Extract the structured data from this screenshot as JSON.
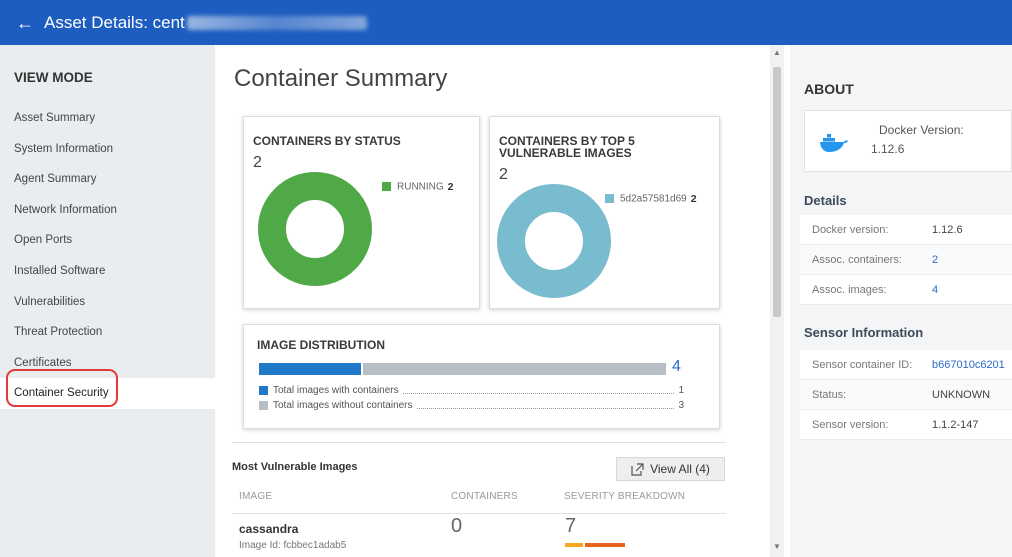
{
  "header": {
    "back_glyph": "←",
    "title": "Asset Details: cent"
  },
  "sidebar": {
    "heading": "VIEW MODE",
    "items": [
      {
        "label": "Asset Summary"
      },
      {
        "label": "System Information"
      },
      {
        "label": "Agent Summary"
      },
      {
        "label": "Network Information"
      },
      {
        "label": "Open Ports"
      },
      {
        "label": "Installed Software"
      },
      {
        "label": "Vulnerabilities"
      },
      {
        "label": "Threat Protection"
      },
      {
        "label": "Certificates"
      },
      {
        "label": "Container Security"
      }
    ],
    "active_index": 9
  },
  "main": {
    "title": "Container Summary",
    "status_card": {
      "title": "CONTAINERS BY STATUS",
      "count": "2",
      "legend_label": "RUNNING",
      "legend_value": "2",
      "color": "#4fa946"
    },
    "vuln_card": {
      "title_line1": "CONTAINERS BY TOP 5",
      "title_line2": "VULNERABLE IMAGES",
      "count": "2",
      "legend_label": "5d2a57581d69",
      "legend_value": "2",
      "color": "#79bcd0"
    },
    "image_dist": {
      "title": "IMAGE DISTRIBUTION",
      "total": "4",
      "with_fraction": 0.25,
      "with_label": "Total images with containers",
      "with_value": "1",
      "without_label": "Total images without containers",
      "without_value": "3",
      "with_color": "#1f78c8",
      "without_color": "#b7bec5"
    },
    "most_vulnerable": {
      "title": "Most Vulnerable Images",
      "view_all": "View All (4)",
      "columns": [
        "IMAGE",
        "CONTAINERS",
        "SEVERITY BREAKDOWN"
      ],
      "rows": [
        {
          "name": "cassandra",
          "image_id": "Image Id: fcbbec1adab5",
          "containers": "0",
          "severity": "7"
        }
      ]
    }
  },
  "about": {
    "title": "ABOUT",
    "docker_label": "Docker Version:",
    "docker_version": "1.12.6",
    "details_title": "Details",
    "details": [
      {
        "key": "Docker version:",
        "value": "1.12.6"
      },
      {
        "key": "Assoc. containers:",
        "value": "2"
      },
      {
        "key": "Assoc. images:",
        "value": "4"
      }
    ],
    "sensor_title": "Sensor Information",
    "sensor": [
      {
        "key": "Sensor container ID:",
        "value": "b667010c6201"
      },
      {
        "key": "Status:",
        "value": "UNKNOWN"
      },
      {
        "key": "Sensor version:",
        "value": "1.1.2-147"
      }
    ]
  }
}
